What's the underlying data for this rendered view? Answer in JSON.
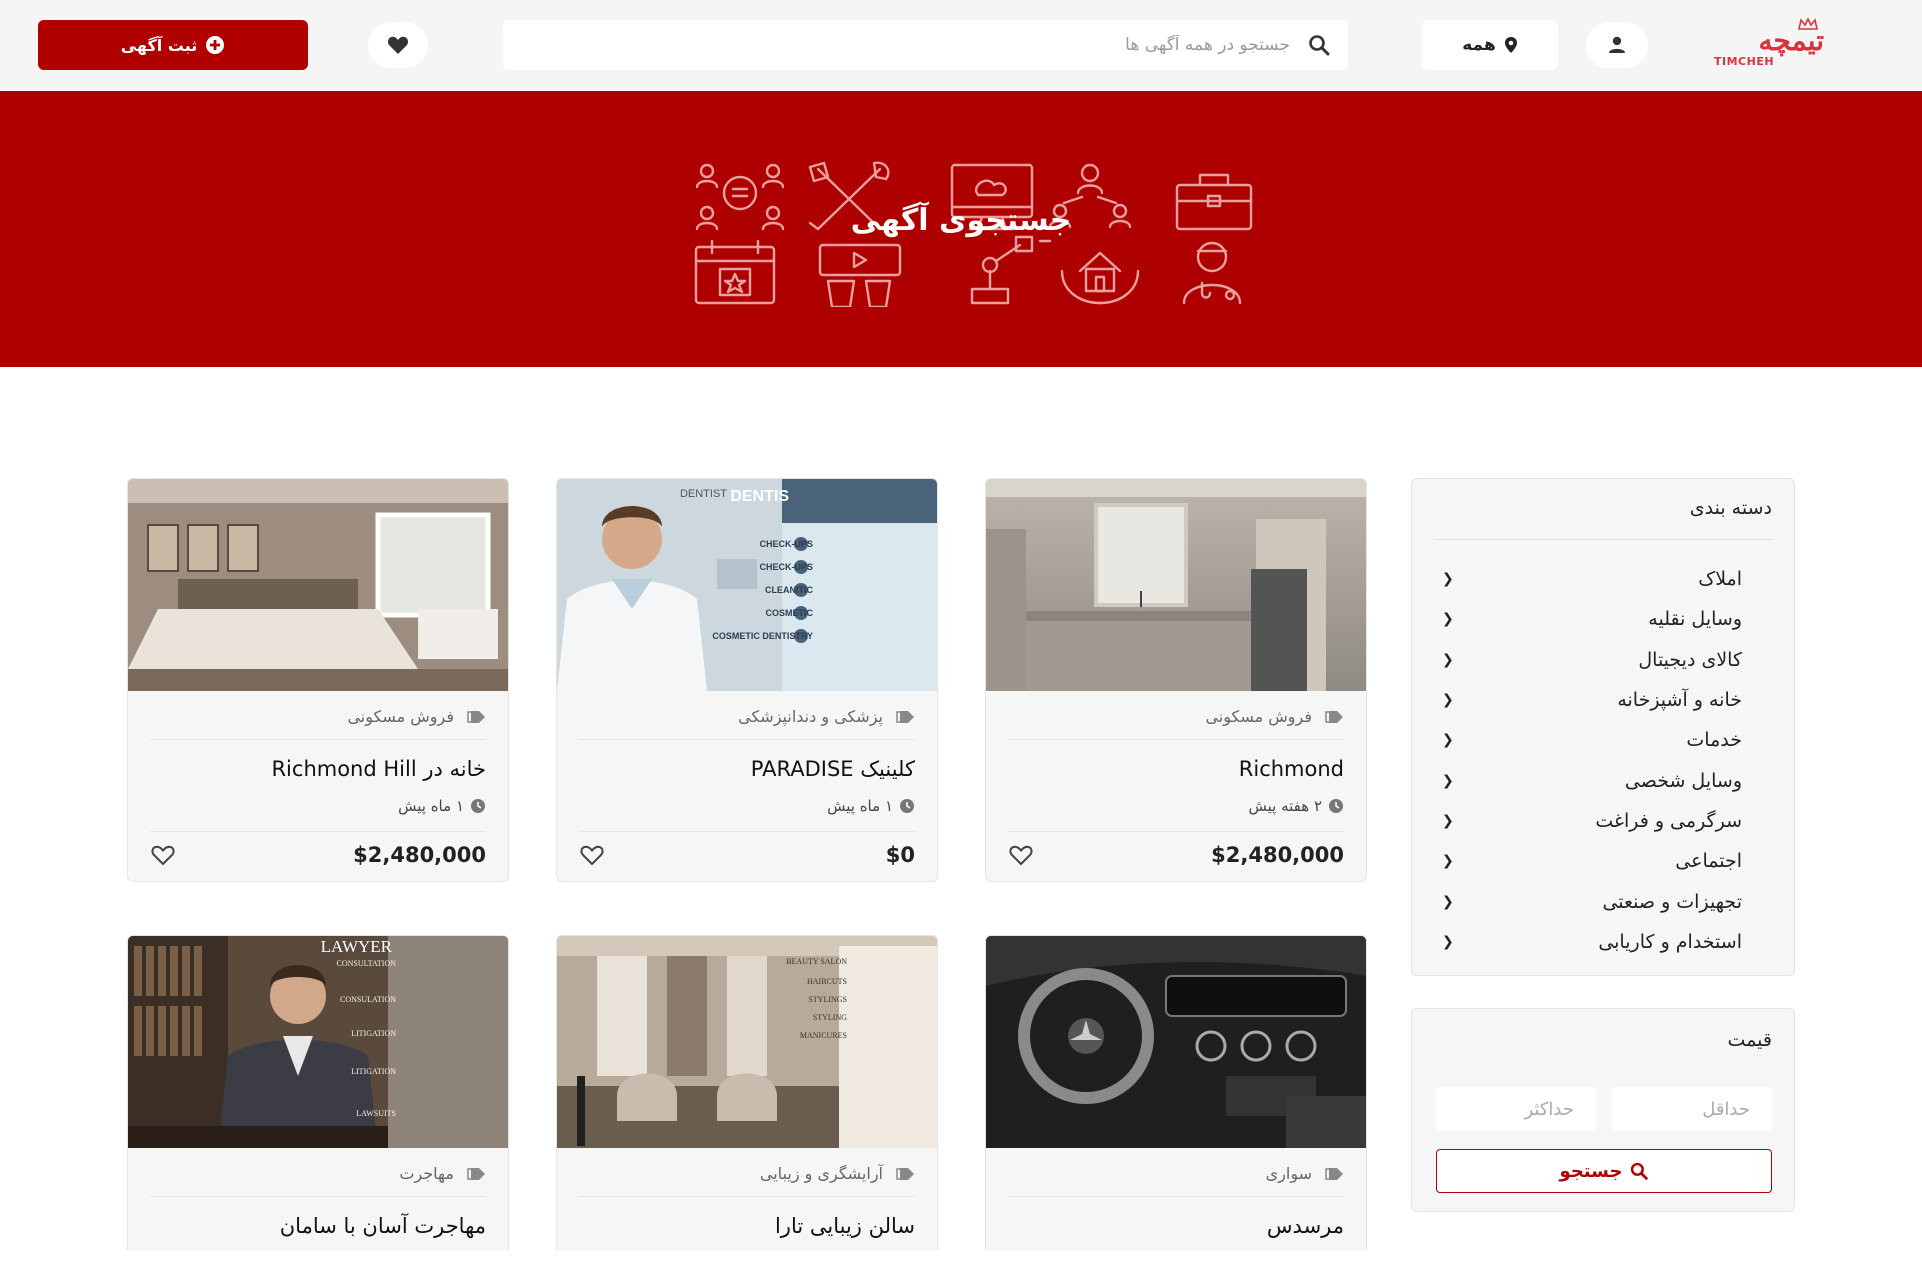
{
  "header": {
    "logo_text": "تیمچه",
    "logo_sub": "TIMCHEH",
    "location_label": "همه",
    "search_placeholder": "جستجو در همه آگهی ها",
    "post_ad_label": "ثبت آگهی"
  },
  "hero": {
    "title": "جستجوی آگهی"
  },
  "sidebar": {
    "categories_title": "دسته بندی",
    "categories": [
      {
        "label": "املاک"
      },
      {
        "label": "وسایل نقلیه"
      },
      {
        "label": "کالای دیجیتال"
      },
      {
        "label": "خانه و آشپزخانه"
      },
      {
        "label": "خدمات"
      },
      {
        "label": "وسایل شخصی"
      },
      {
        "label": "سرگرمی و فراغت"
      },
      {
        "label": "اجتماعی"
      },
      {
        "label": "تجهیزات و صنعتی"
      },
      {
        "label": "استخدام و کاریابی"
      }
    ],
    "price_title": "قیمت",
    "min_placeholder": "حداقل",
    "max_placeholder": "حداکثر",
    "search_label": "جستجو"
  },
  "listings": [
    {
      "category": "فروش مسکونی",
      "title": "Richmond",
      "time": "۲ هفته پیش",
      "price": "$2,480,000",
      "image": "kitchen"
    },
    {
      "category": "پزشکی و دندانپزشکی",
      "title": "کلینیک PARADISE",
      "time": "۱ ماه پیش",
      "price": "$0",
      "image": "dentist",
      "image_text": [
        "DENTIST",
        "DENTIS",
        "CHECK-UPS",
        "CHECK-UPS",
        "CLEANITIC",
        "COSMETIC",
        "COSMETIC DENTISTRY"
      ]
    },
    {
      "category": "فروش مسکونی",
      "title": "خانه در Richmond Hill",
      "time": "۱ ماه پیش",
      "price": "$2,480,000",
      "image": "bedroom"
    },
    {
      "category": "سواری",
      "title": "مرسدس",
      "image": "car"
    },
    {
      "category": "آرایشگری و زیبایی",
      "title": "سالن زیبایی تارا",
      "image": "salon",
      "image_text": [
        "BEAUTY SALON",
        "HAIRCUTS",
        "STYLINGS",
        "STYLING",
        "MANICURES"
      ]
    },
    {
      "category": "مهاجرت",
      "title": "مهاجرت آسان با سامان",
      "image": "lawyer",
      "image_text": [
        "LAWYER",
        "CONSULTATION",
        "CONSULATION",
        "LITIGATION",
        "LITIGATION",
        "LAWSUITS"
      ]
    }
  ],
  "colors": {
    "brand_red": "#af0000",
    "button_red": "#b00000",
    "logo_red": "#d9343b"
  },
  "icons": {
    "user": "user-icon",
    "location": "map-pin-icon",
    "search": "search-icon",
    "favorites": "heart-icon",
    "add": "plus-circle-icon",
    "tag": "tag-icon",
    "time": "clock-icon",
    "chevron": "chevron-left-icon"
  }
}
